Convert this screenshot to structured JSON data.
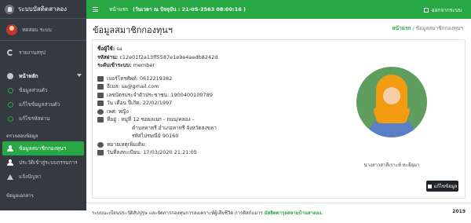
{
  "brand": {
    "title": "ระบบบัสดิตสาลอง"
  },
  "user": {
    "name": "ทดสอบ ระบบ"
  },
  "sidebar": {
    "report": "รายงานสรุป",
    "main_menu": "หน้าหลัก",
    "sub_items": [
      "ข้อมูลส่วนตัว",
      "แก้ไขข้อมูลส่วนตัว",
      "แก้ไขรหัสผ่าน"
    ],
    "section_header": "ตรวจสอบข้อมูล",
    "items": [
      "ข้อมูลสมาชิกกองทุนฯ",
      "ประวัติเข้าสู่ระบบกรรมการ",
      "แจ้งปัญหา"
    ],
    "bottom_header": "ข้อมูลเอกสาร"
  },
  "topbar": {
    "home": "หน้าแรก",
    "date": "(วันเวลา ณ ปัจจุบัน : 21-05-2563 08:00:16 )",
    "logout": "ออกจากระบบ"
  },
  "page": {
    "title": "ข้อมูลสมาชิกกองทุนฯ",
    "breadcrumb_home": "หน้าแรก",
    "breadcrumb_sep": "/",
    "breadcrumb_current": "ข้อมูลสมาชิกกองทุนฯ"
  },
  "profile": {
    "username_label": "ชื่อผู้ใช้:",
    "username": "sa",
    "password_label": "รหัสผ่าน:",
    "password": "c12e01f2a13ff5587e1e9e4aedb8242d",
    "level_label": "ระดับเข้าระบบ:",
    "level": "member",
    "phone": "เบอร์โทรศัพท์: 0612219382",
    "email": "อีเมล: sa@gmail.com",
    "idcard": "เลขบัตรประจำตัวประชาชน: 1900400100789",
    "birthday": "วัน เดือน ปีเกิด: 22/02/1997",
    "gender": "เพศ: หญิง",
    "address_1": "ที่อยู่ : หมู่ที่ 12 ซอย/แยก - ถนน/คลอง -",
    "address_2": "ตำบลหาทรี อำเภอหาทรี จังหวัดสงขลา",
    "address_3": "รหัสไปรษณีย์ 90160",
    "note": "หมายเหตุเพิ่มเติม:",
    "registered": "วันที่ลงทะเบียน: 17/03/2020 21:21:05",
    "photo_caption": "นางสาวสาลีเราะห์ หะยีอุมา",
    "edit_button": "แก้ไขข้อมูล"
  },
  "footer": {
    "text": "ระบบนะเบียนประวัติสัปปุรุษ และจัดการกองทุนการสงเคราะห์ผู้เสียชีวิต การดิสก์แมาร",
    "credit": "มัสยิดดารุลสลามบ้านสาลอง.",
    "year": "2019"
  },
  "colors": {
    "accent": "#28a745",
    "sidebar": "#343a40"
  }
}
